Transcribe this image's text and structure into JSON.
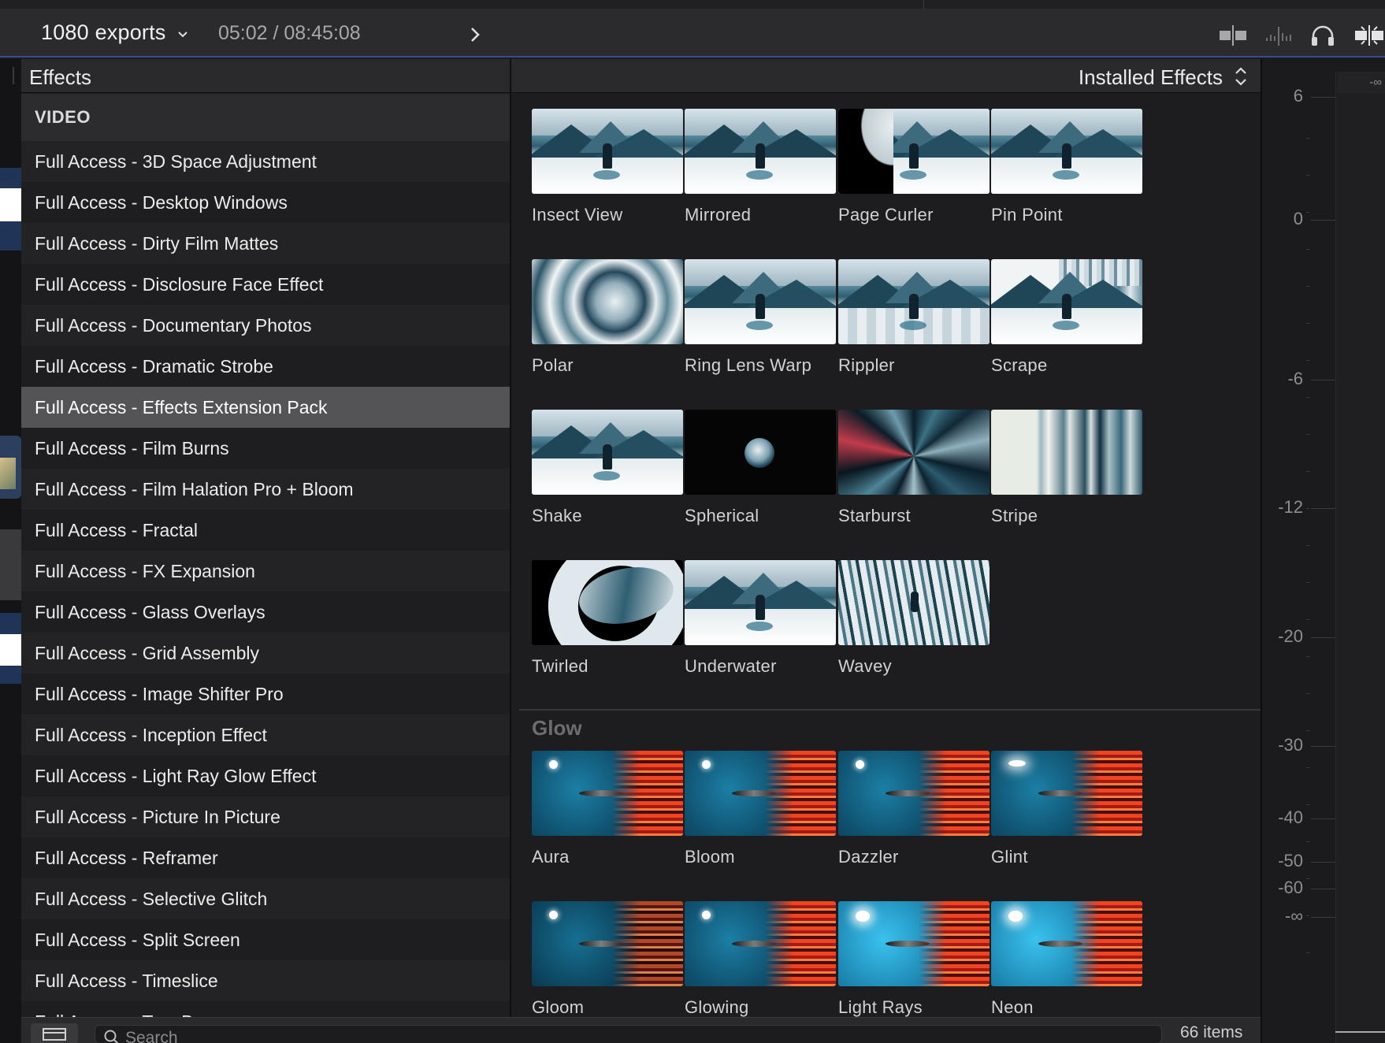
{
  "header": {
    "project_title": "1080 exports",
    "timecode": "05:02 / 08:45:08"
  },
  "panel": {
    "title": "Effects",
    "installed_label": "Installed Effects"
  },
  "categories": {
    "section_label": "VIDEO",
    "items": [
      "Full Access - 3D Space Adjustment",
      "Full Access - Desktop Windows",
      "Full Access - Dirty Film Mattes",
      "Full Access - Disclosure Face Effect",
      "Full Access - Documentary Photos",
      "Full Access - Dramatic Strobe",
      "Full Access - Effects Extension Pack",
      "Full Access - Film Burns",
      "Full Access - Film Halation Pro + Bloom",
      "Full Access - Fractal",
      "Full Access - FX Expansion",
      "Full Access - Glass Overlays",
      "Full Access - Grid Assembly",
      "Full Access - Image Shifter Pro",
      "Full Access - Inception Effect",
      "Full Access - Light Ray Glow Effect",
      "Full Access - Picture In Picture",
      "Full Access - Reframer",
      "Full Access - Selective Glitch",
      "Full Access - Split Screen",
      "Full Access - Timeslice",
      "Full Access - Tom Bar..."
    ],
    "selected": "Full Access - Effects Extension Pack"
  },
  "effects": [
    {
      "label": "Insect View"
    },
    {
      "label": "Mirrored"
    },
    {
      "label": "Page Curler"
    },
    {
      "label": "Pin Point"
    },
    {
      "label": "Polar"
    },
    {
      "label": "Ring Lens Warp"
    },
    {
      "label": "Rippler"
    },
    {
      "label": "Scrape"
    },
    {
      "label": "Shake"
    },
    {
      "label": "Spherical"
    },
    {
      "label": "Starburst"
    },
    {
      "label": "Stripe"
    },
    {
      "label": "Twirled"
    },
    {
      "label": "Underwater"
    },
    {
      "label": "Wavey"
    }
  ],
  "glow_section": {
    "title": "Glow",
    "effects": [
      {
        "label": "Aura"
      },
      {
        "label": "Bloom"
      },
      {
        "label": "Dazzler"
      },
      {
        "label": "Glint"
      },
      {
        "label": "Gloom"
      },
      {
        "label": "Glowing"
      },
      {
        "label": "Light Rays"
      },
      {
        "label": "Neon"
      }
    ]
  },
  "meter": {
    "top_value": "-∞",
    "labels": [
      "6",
      "0",
      "-6",
      "-12",
      "-20",
      "-30",
      "-40",
      "-50",
      "-60",
      "-∞"
    ]
  },
  "bottom": {
    "search_placeholder": "Search",
    "items_count": "66 items"
  },
  "colors": {
    "accent_line": "#2f4f8f",
    "selected_row": "#545456",
    "panel_bg": "#1d1d1f"
  },
  "icons": [
    "chevron-down-icon",
    "chevron-right-icon",
    "view-options-icon",
    "audio-skimming-icon",
    "headphones-icon",
    "snapping-icon",
    "up-down-arrows-icon",
    "sidebar-toggle-icon",
    "search-icon"
  ]
}
